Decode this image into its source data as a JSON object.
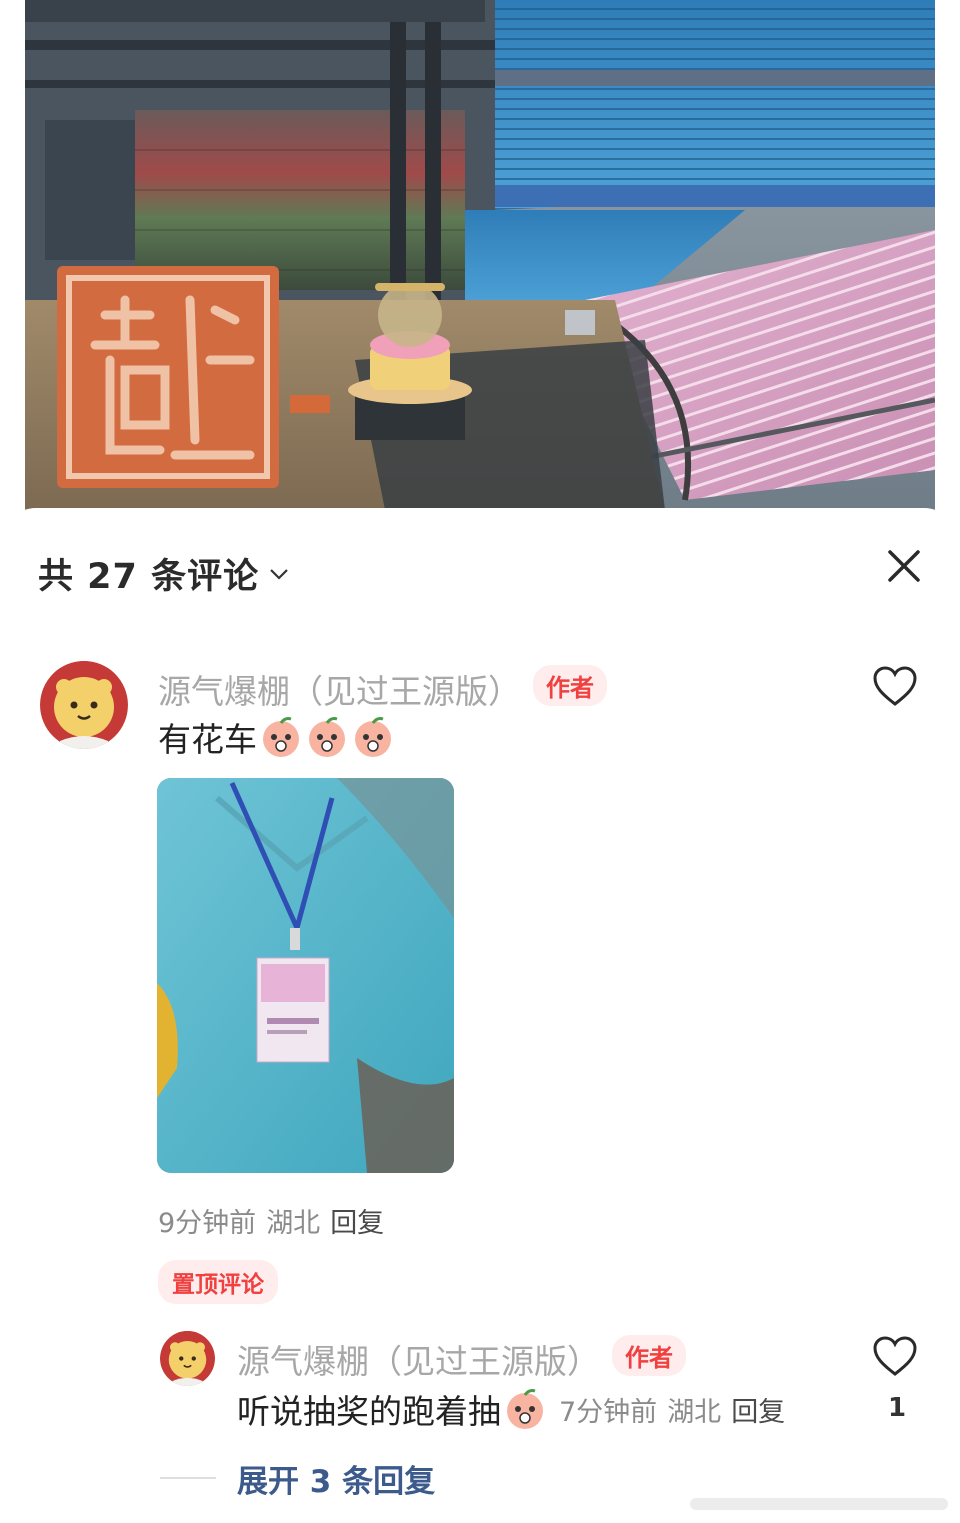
{
  "sheet": {
    "title": "共 27 条评论"
  },
  "comments": [
    {
      "username": "源气爆棚（见过王源版）",
      "badge": "作者",
      "text": "有花车",
      "time": "9分钟前",
      "location": "湖北",
      "reply_label": "回复",
      "pinned_label": "置顶评论",
      "icons": [
        "lion-avatar",
        "peach-emoji",
        "heart-icon"
      ]
    }
  ],
  "reply": {
    "username": "源气爆棚（见过王源版）",
    "badge": "作者",
    "text": "听说抽奖的跑着抽",
    "time": "7分钟前",
    "location": "湖北",
    "reply_label": "回复",
    "likes": "1"
  },
  "expand_label": "展开 3 条回复",
  "colors": {
    "author_badge_bg": "#ffecec",
    "author_badge_text": "#f04040",
    "expand_link": "#3c5a8c"
  }
}
